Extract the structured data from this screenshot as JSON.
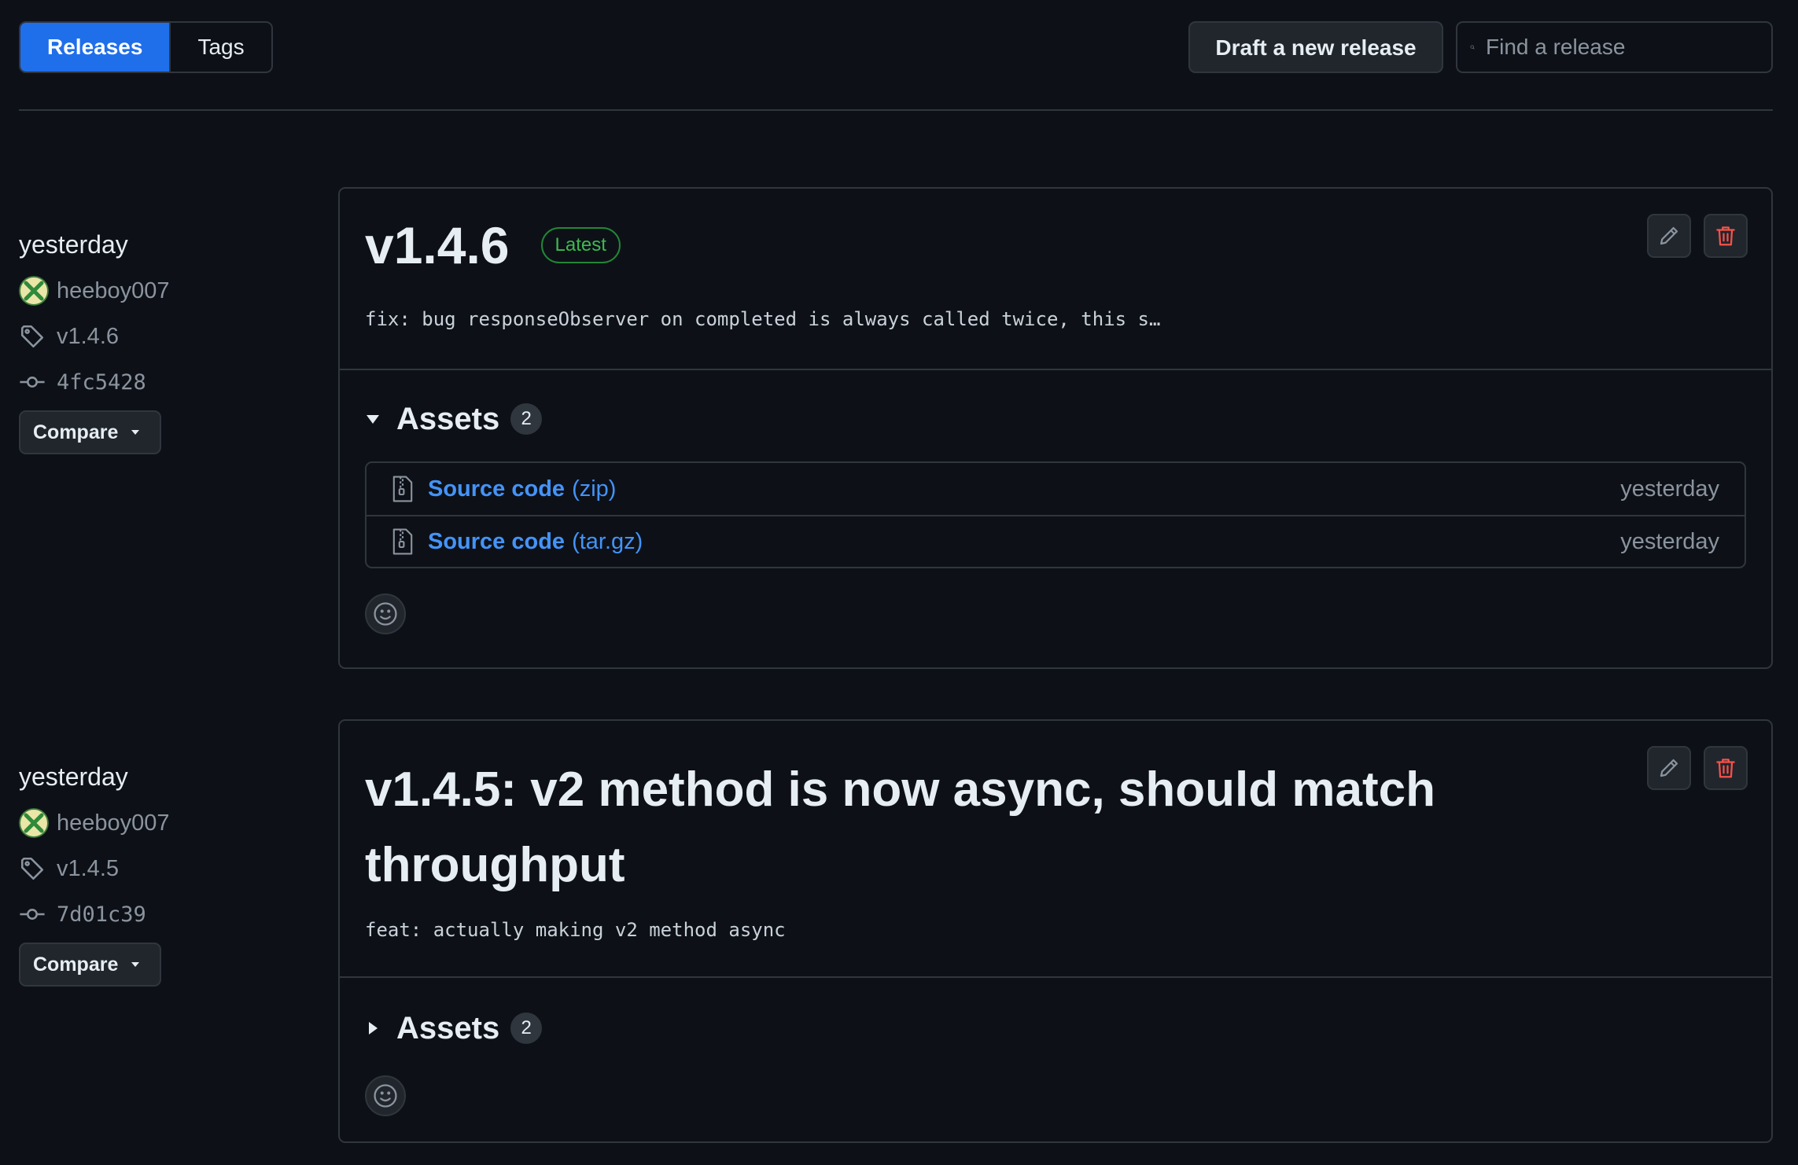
{
  "tabs": [
    {
      "label": "Releases",
      "active": true
    },
    {
      "label": "Tags",
      "active": false
    }
  ],
  "toolbar": {
    "draft_label": "Draft a new release",
    "search_placeholder": "Find a release"
  },
  "releases": [
    {
      "date": "yesterday",
      "author": "heeboy007",
      "tag": "v1.4.6",
      "commit": "4fc5428",
      "compare_label": "Compare",
      "title": "v1.4.6",
      "latest_label": "Latest",
      "description": "fix: bug responseObserver on completed is always called twice, this s…",
      "assets_label": "Assets",
      "assets_count": "2",
      "assets_expanded": true,
      "assets": [
        {
          "name": "Source code",
          "ext": "(zip)",
          "when": "yesterday"
        },
        {
          "name": "Source code",
          "ext": "(tar.gz)",
          "when": "yesterday"
        }
      ]
    },
    {
      "date": "yesterday",
      "author": "heeboy007",
      "tag": "v1.4.5",
      "commit": "7d01c39",
      "compare_label": "Compare",
      "title": "v1.4.5: v2 method is now async, should match throughput",
      "description": "feat: actually making v2 method async",
      "assets_label": "Assets",
      "assets_count": "2",
      "assets_expanded": false
    }
  ],
  "colors": {
    "accent": "#1f6feb",
    "link": "#4493f8",
    "latest": "#3fb950",
    "danger": "#f85149"
  }
}
